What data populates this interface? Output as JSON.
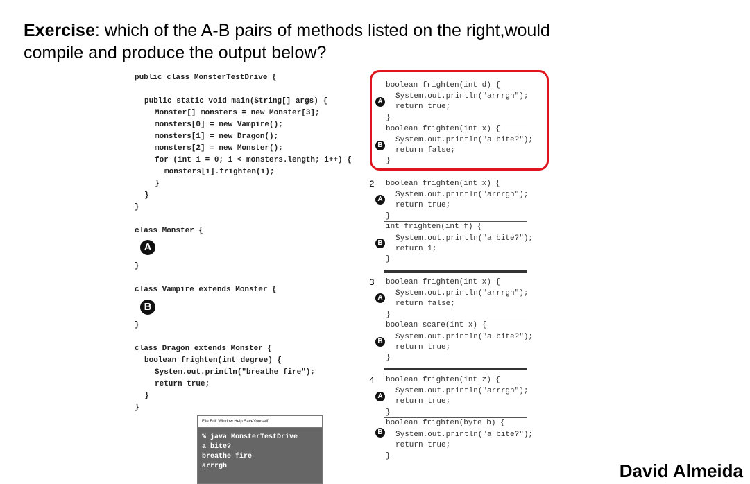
{
  "title": {
    "bold": "Exercise",
    "rest_line1": ": which of the A-B pairs of methods listed on the right,would",
    "line2": "compile and produce the output below?"
  },
  "left_code": [
    "public class MonsterTestDrive {",
    "public static void main(String[] args) {",
    "Monster[] monsters = new Monster[3];",
    "monsters[0] = new Vampire();",
    "monsters[1] = new Dragon();",
    "monsters[2] = new Monster();",
    "for (int i = 0; i < monsters.length; i++) {",
    "monsters[i].frighten(i);",
    "}",
    "}",
    "}",
    "class Monster {",
    "}",
    "class Vampire extends Monster {",
    "}",
    "class Dragon extends Monster {",
    "boolean frighten(int degree) {",
    "System.out.println(\"breathe fire\");",
    "return true;",
    "}",
    "}"
  ],
  "badge_a": "A",
  "badge_b": "B",
  "options": [
    {
      "number": "",
      "a_lines": [
        "boolean frighten(int d) {",
        "System.out.println(\"arrrgh\");",
        "return true;",
        "}"
      ],
      "b_lines": [
        "boolean frighten(int x) {",
        "System.out.println(\"a bite?\");",
        "return false;",
        "}"
      ]
    },
    {
      "number": "2",
      "a_lines": [
        "boolean frighten(int x) {",
        "System.out.println(\"arrrgh\");",
        "return true;",
        "}"
      ],
      "b_lines": [
        "int frighten(int f) {",
        "System.out.println(\"a bite?\");",
        "return 1;",
        "}"
      ]
    },
    {
      "number": "3",
      "a_lines": [
        "boolean frighten(int x) {",
        "System.out.println(\"arrrgh\");",
        "return false;",
        "}"
      ],
      "b_lines": [
        "boolean scare(int x) {",
        "System.out.println(\"a bite?\");",
        "return true;",
        "}"
      ]
    },
    {
      "number": "4",
      "a_lines": [
        "boolean frighten(int z) {",
        "System.out.println(\"arrrgh\");",
        "return true;",
        "}"
      ],
      "b_lines": [
        "boolean frighten(byte b) {",
        "System.out.println(\"a bite?\");",
        "return true;",
        "}"
      ]
    }
  ],
  "terminal": {
    "menu": "File  Edit  Window  Help  SaveYourself",
    "lines": [
      "% java MonsterTestDrive",
      "a bite?",
      "breathe fire",
      "arrrgh"
    ]
  },
  "author": "David Almeida",
  "colors": {
    "highlight": "#e0141e",
    "terminal_bg": "#666666"
  }
}
